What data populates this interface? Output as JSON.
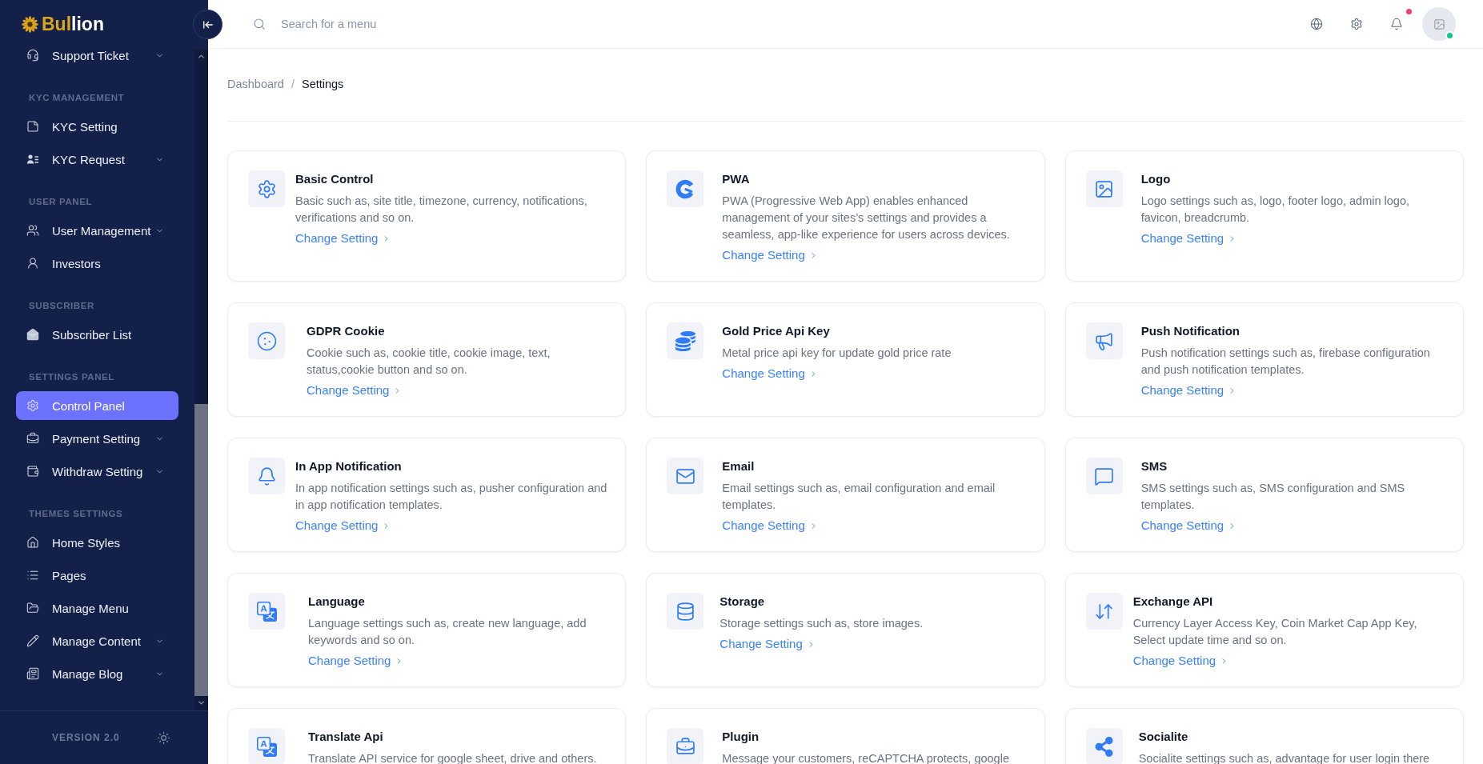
{
  "sidebar": {
    "logo": {
      "accent": "Bul",
      "rest": "lion"
    },
    "sections": [
      {
        "items": [
          {
            "label": "Support Ticket",
            "has_submenu": true,
            "selected": false
          }
        ]
      },
      {
        "heading": "KYC MANAGEMENT",
        "items": [
          {
            "label": "KYC Setting",
            "has_submenu": false,
            "selected": false
          },
          {
            "label": "KYC Request",
            "has_submenu": true,
            "selected": false
          }
        ]
      },
      {
        "heading": "USER PANEL",
        "items": [
          {
            "label": "User Management",
            "has_submenu": true,
            "selected": false
          },
          {
            "label": "Investors",
            "has_submenu": false,
            "selected": false
          }
        ]
      },
      {
        "heading": "SUBSCRIBER",
        "items": [
          {
            "label": "Subscriber List",
            "has_submenu": false,
            "selected": false
          }
        ]
      },
      {
        "heading": "SETTINGS PANEL",
        "items": [
          {
            "label": "Control Panel",
            "has_submenu": false,
            "selected": true
          },
          {
            "label": "Payment Setting",
            "has_submenu": true,
            "selected": false
          },
          {
            "label": "Withdraw Setting",
            "has_submenu": true,
            "selected": false
          }
        ]
      },
      {
        "heading": "THEMES SETTINGS",
        "items": [
          {
            "label": "Home Styles",
            "has_submenu": false,
            "selected": false
          },
          {
            "label": "Pages",
            "has_submenu": false,
            "selected": false
          },
          {
            "label": "Manage Menu",
            "has_submenu": false,
            "selected": false
          },
          {
            "label": "Manage Content",
            "has_submenu": true,
            "selected": false
          },
          {
            "label": "Manage Blog",
            "has_submenu": true,
            "selected": false
          }
        ]
      }
    ],
    "footer": {
      "version": "VERSION 2.0"
    }
  },
  "header": {
    "search": {
      "placeholder": "Search for a menu"
    },
    "notifications": {
      "unread": true
    },
    "user": {
      "online": true
    }
  },
  "breadcrumb": {
    "separator": "/",
    "items": [
      {
        "label": "Dashboard",
        "current": false
      },
      {
        "label": "Settings",
        "current": true
      }
    ]
  },
  "cards": [
    {
      "title": "Basic Control",
      "description": "Basic such as, site title, timezone, currency, notifications, verifications and so on.",
      "link": "Change Setting"
    },
    {
      "title": "PWA",
      "description": "PWA (Progressive Web App) enables enhanced management of your sites’s settings and provides a seamless, app-like experience for users across devices.",
      "link": "Change Setting"
    },
    {
      "title": "Logo",
      "description": "Logo settings such as, logo, footer logo, admin logo, favicon, breadcrumb.",
      "link": "Change Setting"
    },
    {
      "title": "GDPR Cookie",
      "description": "Cookie such as, cookie title, cookie image, text, status,cookie button and so on.",
      "link": "Change Setting"
    },
    {
      "title": "Gold Price Api Key",
      "description": "Metal price api key for update gold price rate",
      "link": "Change Setting"
    },
    {
      "title": "Push Notification",
      "description": "Push notification settings such as, firebase configuration and push notification templates.",
      "link": "Change Setting"
    },
    {
      "title": "In App Notification",
      "description": "In app notification settings such as, pusher configuration and in app notification templates.",
      "link": "Change Setting"
    },
    {
      "title": "Email",
      "description": "Email settings such as, email configuration and email templates.",
      "link": "Change Setting"
    },
    {
      "title": "SMS",
      "description": "SMS settings such as, SMS configuration and SMS templates.",
      "link": "Change Setting"
    },
    {
      "title": "Language",
      "description": "Language settings such as, create new language, add keywords and so on.",
      "link": "Change Setting"
    },
    {
      "title": "Storage",
      "description": "Storage settings such as, store images.",
      "link": "Change Setting"
    },
    {
      "title": "Exchange API",
      "description": "Currency Layer Access Key, Coin Market Cap App Key, Select update time and so on.",
      "link": "Change Setting"
    },
    {
      "title": "Translate Api",
      "description": "Translate API service for google sheet, drive and others."
    },
    {
      "title": "Plugin",
      "description": "Message your customers, reCAPTCHA protects, google"
    },
    {
      "title": "Socialite",
      "description": "Socialite settings such as, advantage for user login there"
    }
  ]
}
